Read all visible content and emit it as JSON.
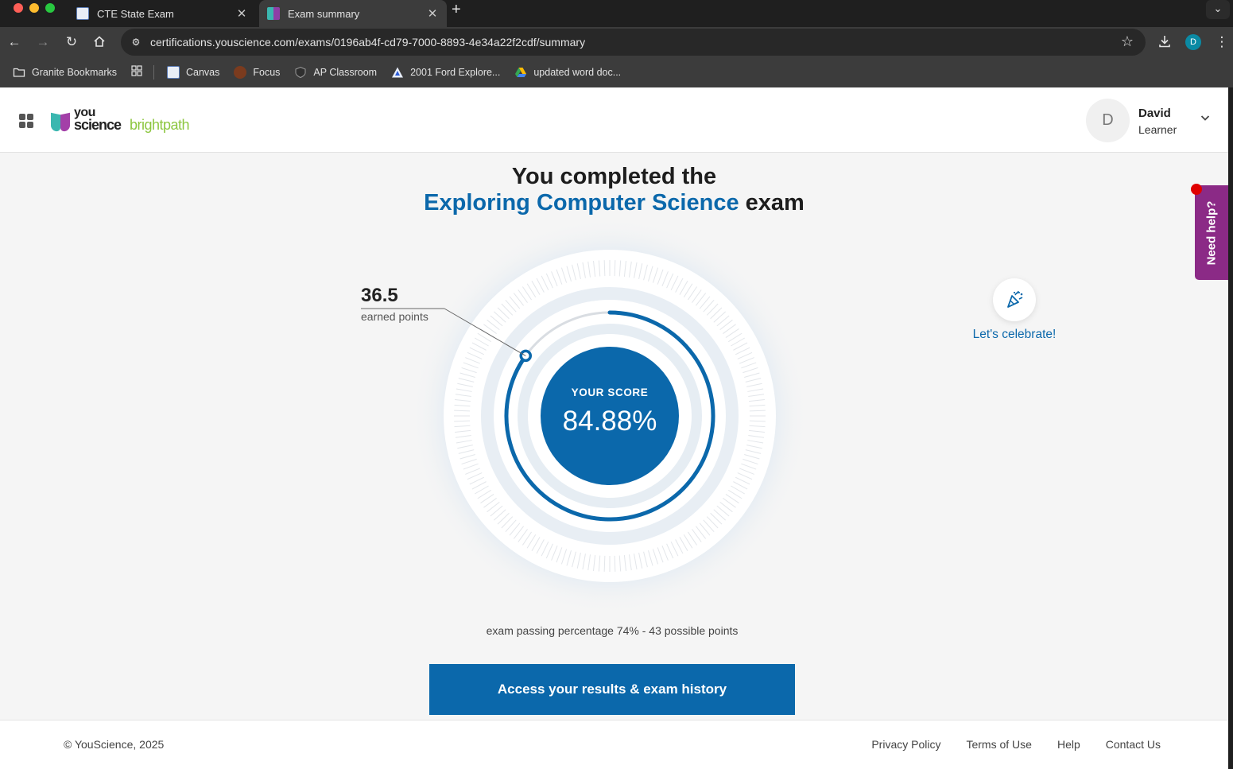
{
  "browser": {
    "tabs": [
      {
        "title": "CTE State Exam",
        "active": false
      },
      {
        "title": "Exam summary",
        "active": true
      }
    ],
    "new_tab_icon": "plus-icon",
    "url": "certifications.youscience.com/exams/0196ab4f-cd79-7000-8893-4e34a22f2cdf/summary",
    "profile_initial": "D",
    "bookmarks": [
      {
        "label": "Granite Bookmarks",
        "icon": "folder-icon"
      },
      {
        "label": "Canvas",
        "icon": "canvas-favicon"
      },
      {
        "label": "Focus",
        "icon": "focus-favicon"
      },
      {
        "label": "AP Classroom",
        "icon": "ap-favicon"
      },
      {
        "label": "2001 Ford Explore...",
        "icon": "a-favicon"
      },
      {
        "label": "updated word doc...",
        "icon": "drive-icon"
      }
    ]
  },
  "header": {
    "logo": {
      "you": "you",
      "science": "science",
      "brightpath": "brightpath"
    },
    "user": {
      "initial": "D",
      "name": "David",
      "role": "Learner"
    }
  },
  "summary": {
    "headline_line1": "You completed the",
    "exam_name": "Exploring Computer Science",
    "headline_suffix": "exam",
    "earned_points": "36.5",
    "earned_points_label": "earned points",
    "score_label": "YOUR SCORE",
    "score_value": "84.88%",
    "score_fraction": 0.8488,
    "celebrate_label": "Let's celebrate!",
    "passing_text": "exam passing percentage 74% - 43 possible points",
    "cta_label": "Access your results & exam history"
  },
  "help_tab": {
    "label": "Need help?"
  },
  "footer": {
    "copyright": "© YouScience, 2025",
    "links": [
      "Privacy Policy",
      "Terms of Use",
      "Help",
      "Contact Us"
    ]
  },
  "colors": {
    "accent": "#0b68ab",
    "help_tab": "#8b2a86",
    "brightpath_green": "#8cc63f"
  }
}
